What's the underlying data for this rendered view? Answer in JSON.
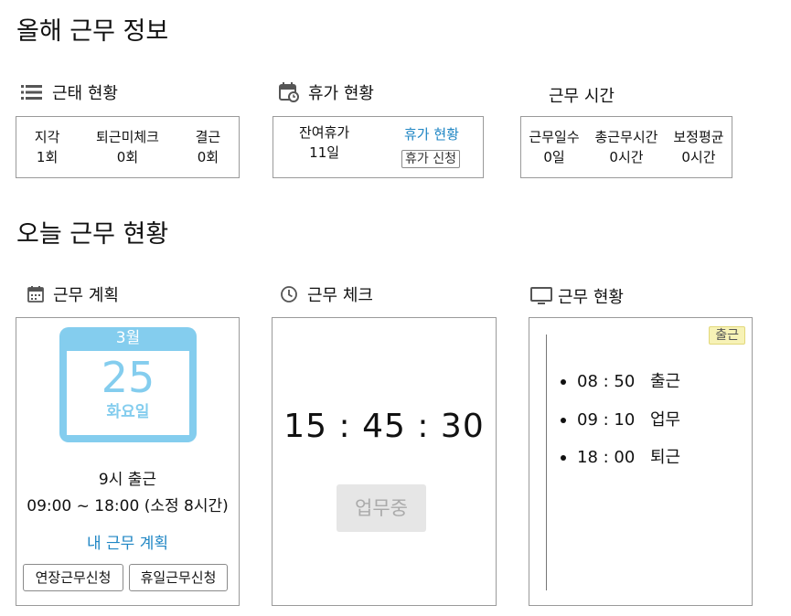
{
  "annual": {
    "title": "올해 근무 정보",
    "attendance": {
      "title": "근태 현황",
      "stats": [
        {
          "label": "지각",
          "value": "1회"
        },
        {
          "label": "퇴근미체크",
          "value": "0회"
        },
        {
          "label": "결근",
          "value": "0회"
        }
      ]
    },
    "leave": {
      "title": "휴가 현황",
      "remaining_label": "잔여휴가",
      "remaining_value": "11일",
      "status_link": "휴가 현황",
      "apply_button": "휴가 신청"
    },
    "hours": {
      "title": "근무 시간",
      "stats": [
        {
          "label": "근무일수",
          "value": "0일"
        },
        {
          "label": "총근무시간",
          "value": "0시간"
        },
        {
          "label": "보정평균",
          "value": "0시간"
        }
      ]
    }
  },
  "today": {
    "title": "오늘 근무 현황",
    "plan": {
      "title": "근무 계획",
      "calendar": {
        "month": "3월",
        "day": "25",
        "weekday": "화요일"
      },
      "start_text": "9시 출근",
      "schedule": "09:00 ~ 18:00 (소정 8시간)",
      "my_plan_link": "내 근무 계획",
      "overtime_button": "연장근무신청",
      "holiday_button": "휴일근무신청"
    },
    "check": {
      "title": "근무 체크",
      "clock": "15 : 45 : 30",
      "status_button": "업무중"
    },
    "status": {
      "title": "근무 현황",
      "badge": "출근",
      "log": [
        {
          "time": "08 : 50",
          "label": "출근"
        },
        {
          "time": "09 : 10",
          "label": "업무"
        },
        {
          "time": "18 : 00",
          "label": "퇴근"
        }
      ]
    }
  },
  "colors": {
    "accent": "#1f86c4",
    "calendar": "#84cdee",
    "badge_bg": "#f7f2b6"
  }
}
